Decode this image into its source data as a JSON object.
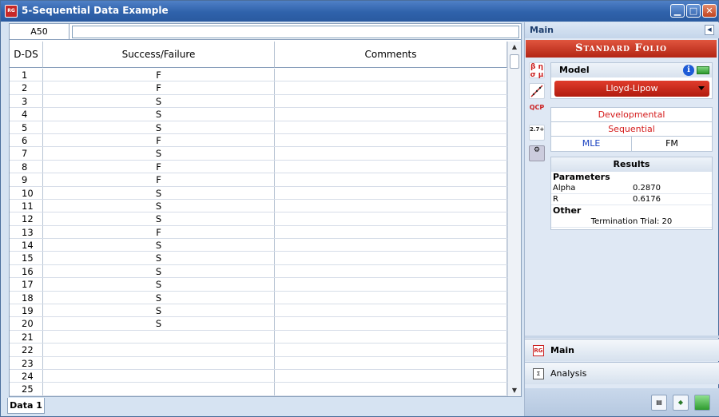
{
  "window": {
    "title": "5-Sequential Data Example",
    "app_badge": "RG"
  },
  "grid": {
    "cell_ref": "A50",
    "formula": "",
    "columns": [
      "D-DS",
      "Success/Failure",
      "Comments"
    ],
    "rows": [
      {
        "n": "1",
        "v": "F"
      },
      {
        "n": "2",
        "v": "F"
      },
      {
        "n": "3",
        "v": "S"
      },
      {
        "n": "4",
        "v": "S"
      },
      {
        "n": "5",
        "v": "S"
      },
      {
        "n": "6",
        "v": "F"
      },
      {
        "n": "7",
        "v": "S"
      },
      {
        "n": "8",
        "v": "F"
      },
      {
        "n": "9",
        "v": "F"
      },
      {
        "n": "10",
        "v": "S"
      },
      {
        "n": "11",
        "v": "S"
      },
      {
        "n": "12",
        "v": "S"
      },
      {
        "n": "13",
        "v": "F"
      },
      {
        "n": "14",
        "v": "S"
      },
      {
        "n": "15",
        "v": "S"
      },
      {
        "n": "16",
        "v": "S"
      },
      {
        "n": "17",
        "v": "S"
      },
      {
        "n": "18",
        "v": "S"
      },
      {
        "n": "19",
        "v": "S"
      },
      {
        "n": "20",
        "v": "S"
      },
      {
        "n": "21",
        "v": ""
      },
      {
        "n": "22",
        "v": ""
      },
      {
        "n": "23",
        "v": ""
      },
      {
        "n": "24",
        "v": ""
      },
      {
        "n": "25",
        "v": ""
      }
    ],
    "sheet_tab": "Data 1"
  },
  "panel": {
    "header": "Main",
    "folio_title": "Standard Folio",
    "model_label": "Model",
    "model_value": "Lloyd-Lipow",
    "settings": {
      "row1": "Developmental",
      "row2": "Sequential",
      "method": "MLE",
      "mode": "FM"
    },
    "results": {
      "title": "Results",
      "parameters_label": "Parameters",
      "alpha_label": "Alpha",
      "alpha_value": "0.2870",
      "r_label": "R",
      "r_value": "0.6176",
      "other_label": "Other",
      "termination": "Termination Trial: 20"
    },
    "nav": {
      "main": "Main",
      "analysis": "Analysis"
    },
    "side_icons": [
      "β η σ μ",
      "plot",
      "QCP",
      "2.7+",
      "gear"
    ]
  },
  "colors": {
    "accent_red": "#c0311f",
    "title_blue": "#2f62ab",
    "link_blue": "#1740c0"
  }
}
